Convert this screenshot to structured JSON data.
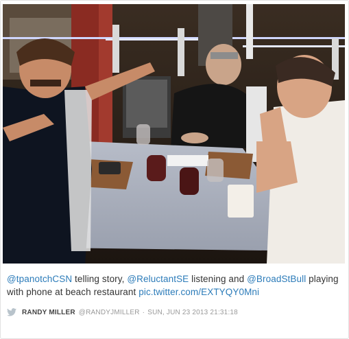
{
  "tweet": {
    "mention_1": "@tpanotchCSN",
    "text_1": " telling story, ",
    "mention_2": "@ReluctantSE",
    "text_2": " listening and ",
    "mention_3": "@BroadStBull",
    "text_3": " playing with phone at beach restaurant ",
    "link": "pic.twitter.com/EXTYQY0Mni"
  },
  "meta": {
    "icon": "twitter-bird-icon",
    "author": "RANDY MILLER",
    "handle": "@RANDYJMILLER",
    "separator": "·",
    "date": "SUN, JUN 23 2013 21:31:18"
  },
  "colors": {
    "link": "#2b7bb9",
    "text": "#333333",
    "meta": "#999999",
    "bird": "#b8c3cb"
  }
}
